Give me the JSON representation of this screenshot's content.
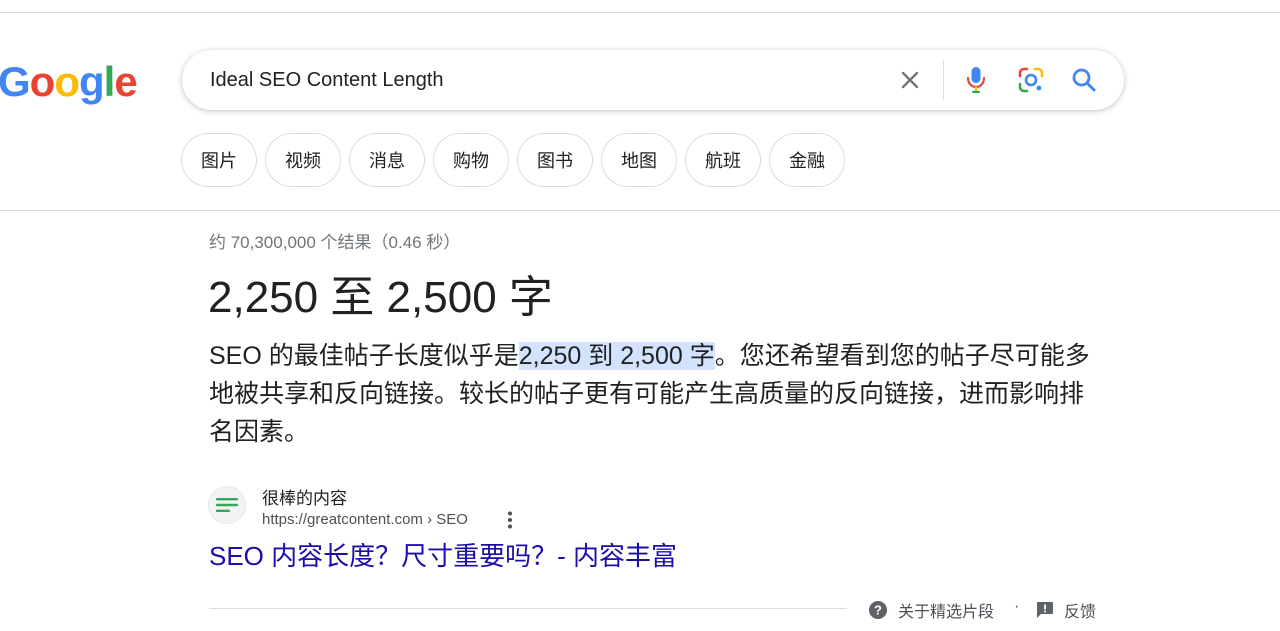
{
  "logo": {
    "letters": [
      "G",
      "o",
      "o",
      "g",
      "l",
      "e"
    ],
    "colors": [
      "#4285f4",
      "#ea4335",
      "#fbbc05",
      "#4285f4",
      "#34a853",
      "#ea4335"
    ]
  },
  "search": {
    "query": "Ideal SEO Content Length",
    "icons": {
      "clear": "close-icon",
      "mic": "mic-icon",
      "lens": "lens-icon",
      "search": "search-icon"
    }
  },
  "tabs": [
    {
      "label": "图片"
    },
    {
      "label": "视频"
    },
    {
      "label": "消息"
    },
    {
      "label": "购物"
    },
    {
      "label": "图书"
    },
    {
      "label": "地图"
    },
    {
      "label": "航班"
    },
    {
      "label": "金融"
    }
  ],
  "result_stats": "约 70,300,000 个结果（0.46 秒）",
  "featured": {
    "title": "2,250 至 2,500 字",
    "snippet_before": "SEO 的最佳帖子长度似乎是",
    "snippet_highlight": "2,250 到 2,500 字",
    "snippet_after": "。您还希望看到您的帖子尽可能多地被共享和反向链接。较长的帖子更有可能产生高质量的反向链接，进而影响排名因素。",
    "source": {
      "site_name": "很棒的内容",
      "url": "https://greatcontent.com › SEO",
      "favicon_color": "#34a853"
    },
    "link_title": "SEO 内容长度？尺寸重要吗？- 内容丰富",
    "link_color": "#1a0dab",
    "highlight_color": "#d3e3fd"
  },
  "footer": {
    "about_label": "关于精选片段",
    "separator": "·",
    "feedback_label": "反馈"
  }
}
